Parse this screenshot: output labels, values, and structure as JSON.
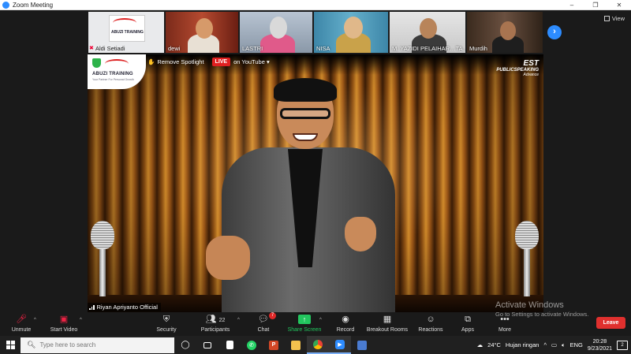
{
  "window": {
    "title": "Zoom Meeting",
    "controls": [
      "–",
      "❐",
      "✕"
    ]
  },
  "gallery": {
    "participants": [
      {
        "name": "Aldi Setiadi",
        "muted": true,
        "logo_text": "ABUZI TRAINING"
      },
      {
        "name": "dewi",
        "muted": false
      },
      {
        "name": "LASTRI",
        "muted": false
      },
      {
        "name": "NISA",
        "muted": false
      },
      {
        "name": "M. YAZIDI PELAIHAR…TA…",
        "muted": false
      },
      {
        "name": "Murdih",
        "muted": false
      }
    ],
    "next_label": "›",
    "view_label": "View"
  },
  "main": {
    "logo_text": "ABUZI TRAINING",
    "logo_sub": "Your Partner For Personal Growth",
    "remove_spotlight": "Remove Spotlight",
    "live": "LIVE",
    "live_on": "on YouTube",
    "brand_line1": "EST",
    "brand_line2": "PUBLICSPEAKING",
    "brand_line3": "Advance",
    "speaker_name": "Riyan Apriyanto Official"
  },
  "toolbar": {
    "unmute": "Unmute",
    "start_video": "Start Video",
    "security": "Security",
    "participants": "Participants",
    "participants_count": "22",
    "chat": "Chat",
    "chat_badge": "7",
    "share_screen": "Share Screen",
    "record": "Record",
    "breakout_rooms": "Breakout Rooms",
    "reactions": "Reactions",
    "apps": "Apps",
    "more": "More",
    "leave": "Leave"
  },
  "watermark": {
    "line1": "Activate Windows",
    "line2": "Go to Settings to activate Windows."
  },
  "taskbar": {
    "search_placeholder": "Type here to search",
    "weather_temp": "24°C",
    "weather_text": "Hujan ringan",
    "language": "ENG",
    "time": "20:28",
    "date": "9/23/2021",
    "notification_count": "2"
  },
  "colors": {
    "zoom_blue": "#2d8cff",
    "leave_red": "#e0302e",
    "share_green": "#22c55e",
    "live_red": "#e02020"
  }
}
